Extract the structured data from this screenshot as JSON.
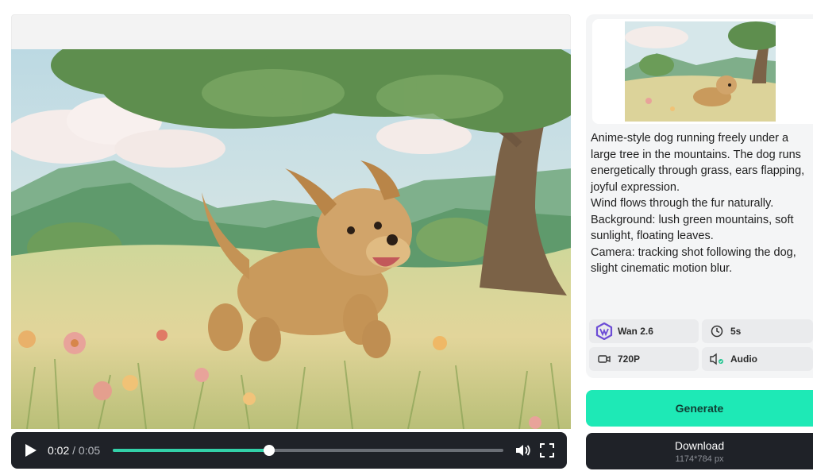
{
  "player": {
    "current_time": "0:02",
    "separator": " / ",
    "total_time": "0:05",
    "progress_fraction": 0.4
  },
  "panel": {
    "prompt": "Anime-style dog running freely under a large tree in the mountains. The dog runs energetically through grass, ears flapping, joyful expression.\nWind flows through the fur naturally.\nBackground: lush green mountains, soft sunlight, floating leaves.\nCamera: tracking shot following the dog, slight cinematic motion blur.",
    "options": {
      "model": "Wan 2.6",
      "duration": "5s",
      "resolution": "720P",
      "audio": "Audio"
    }
  },
  "actions": {
    "generate_label": "Generate",
    "download_label": "Download",
    "download_size": "1174*784 px"
  },
  "icons": {
    "play": "play-icon",
    "volume": "volume-icon",
    "fullscreen": "fullscreen-icon",
    "model": "wan-logo-icon",
    "duration": "clock-icon",
    "resolution": "video-camera-icon",
    "audio": "speaker-icon"
  },
  "colors": {
    "accent": "#1ee9b6",
    "progress": "#33d1a9",
    "dark": "#1f2228"
  }
}
